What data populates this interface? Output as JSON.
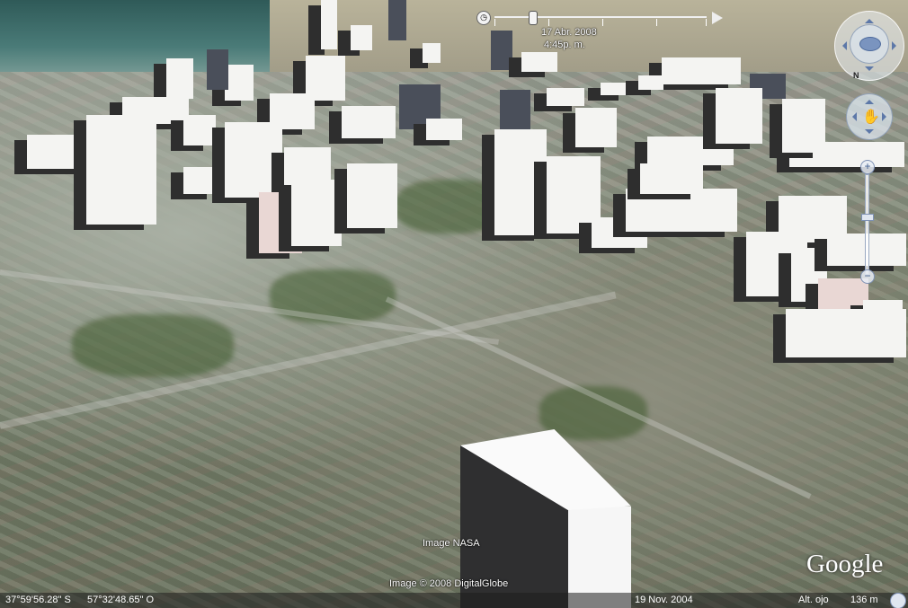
{
  "app": {
    "name": "Google Earth 3D view"
  },
  "time_slider": {
    "date": "17 Abr. 2008",
    "time": "4:45p. m."
  },
  "attribution": {
    "imagery_nasa": "Image NASA",
    "imagery_copyright": "Image © 2008 DigitalGlobe",
    "logo": "Google"
  },
  "status_bar": {
    "latitude": "37°59'56.28\" S",
    "longitude": "57°32'48.65\" O",
    "imagery_date": "19 Nov. 2004",
    "eye_alt_label": "Alt. ojo",
    "eye_alt_value": "136 m"
  },
  "controls": {
    "north_label": "N",
    "zoom_in": "+",
    "zoom_out": "−"
  },
  "colors": {
    "building_light": "#f4f4f2",
    "building_shadow": "#2e2e2e",
    "sea": "#2f5a58"
  }
}
